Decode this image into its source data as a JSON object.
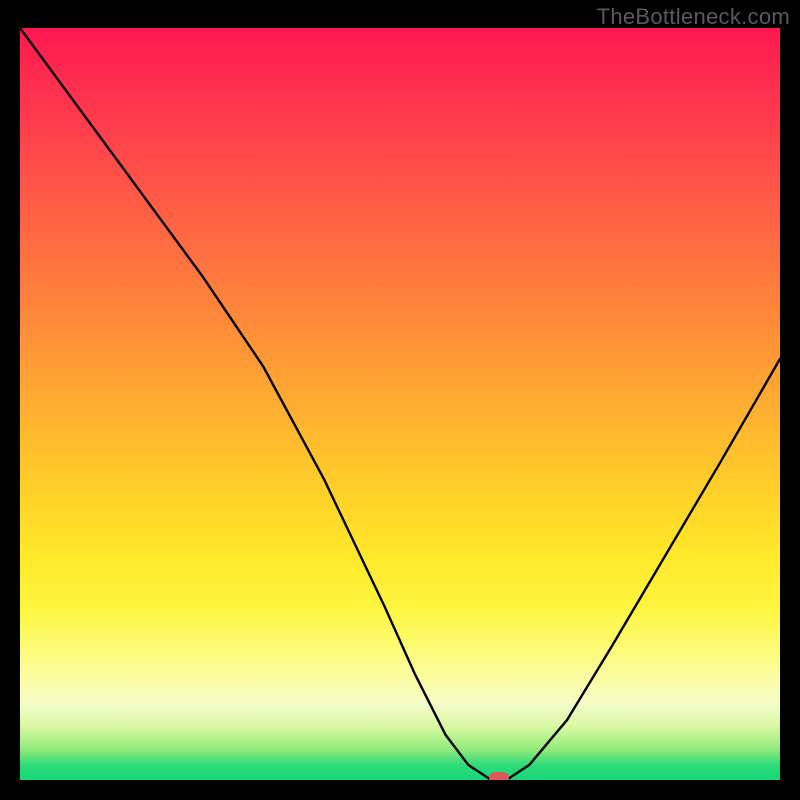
{
  "watermark": "TheBottleneck.com",
  "chart_data": {
    "type": "line",
    "title": "",
    "xlabel": "",
    "ylabel": "",
    "xlim": [
      0,
      100
    ],
    "ylim": [
      0,
      100
    ],
    "series": [
      {
        "name": "bottleneck-curve",
        "x": [
          0,
          8,
          16,
          24,
          32,
          40,
          48,
          52,
          56,
          59,
          62,
          64,
          67,
          72,
          78,
          85,
          92,
          100
        ],
        "values": [
          100,
          89,
          78,
          67,
          55,
          40,
          23,
          14,
          6,
          2,
          0,
          0,
          2,
          8,
          18,
          30,
          42,
          56
        ]
      }
    ],
    "annotations": [
      {
        "name": "optimum-marker",
        "x": 63,
        "y": 0,
        "color": "#db5a58"
      }
    ],
    "background_gradient": {
      "top": "#ff1850",
      "mid": "#ffe82a",
      "bottom": "#17d877"
    }
  }
}
